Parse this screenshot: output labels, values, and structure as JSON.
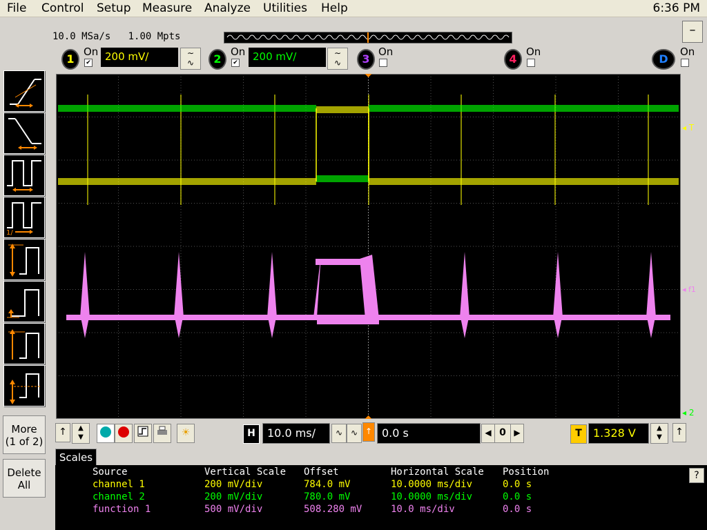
{
  "menu": {
    "items": [
      "File",
      "Control",
      "Setup",
      "Measure",
      "Analyze",
      "Utilities",
      "Help"
    ],
    "clock": "6:36 PM"
  },
  "acquisition": {
    "sample_rate": "10.0 MSa/s",
    "memory_depth": "1.00 Mpts"
  },
  "channels": [
    {
      "number": "1",
      "on_label": "On",
      "checked": true,
      "scale": "200 mV/",
      "color": "#ffff00"
    },
    {
      "number": "2",
      "on_label": "On",
      "checked": true,
      "scale": "200 mV/",
      "color": "#00ff00"
    },
    {
      "number": "3",
      "on_label": "On",
      "checked": false,
      "color": "#b040ff"
    },
    {
      "number": "4",
      "on_label": "On",
      "checked": false,
      "color": "#ff2060"
    },
    {
      "number": "D",
      "on_label": "On",
      "checked": false,
      "color": "#2080ff"
    }
  ],
  "left_panel": {
    "more_label_1": "More",
    "more_label_2": "(1 of 2)",
    "delete_label_1": "Delete",
    "delete_label_2": "All"
  },
  "screen_markers": {
    "trigger_marker": "T",
    "function_marker": "f1",
    "ch2_marker": "2"
  },
  "horizontal": {
    "label": "H",
    "scale": "10.0 ms/",
    "position": "0.0 s",
    "zoom_value": "0"
  },
  "trigger": {
    "label": "T",
    "level": "1.328 V"
  },
  "scales": {
    "tab_label": "Scales",
    "help": "?",
    "headers": [
      "Source",
      "Vertical Scale",
      "Offset",
      "Horizontal Scale",
      "Position"
    ],
    "rows": [
      {
        "source": "channel 1",
        "vscale": "200 mV/div",
        "offset": "784.0 mV",
        "hscale": "10.0000 ms/div",
        "position": "0.0 s",
        "color": "#ffff00"
      },
      {
        "source": "channel 2",
        "vscale": "200 mV/div",
        "offset": "780.0 mV",
        "hscale": "10.0000 ms/div",
        "position": "0.0 s",
        "color": "#00ff00"
      },
      {
        "source": "function 1",
        "vscale": "500 mV/div",
        "offset": "508.280 mV",
        "hscale": "10.0 ms/div",
        "position": "0.0 s",
        "color": "#ee82ee"
      }
    ]
  },
  "colors": {
    "ch1": "#ffff00",
    "ch2": "#00ff00",
    "func1": "#ee82ee",
    "trigger_orange": "#ff8800",
    "grid": "#555555"
  }
}
